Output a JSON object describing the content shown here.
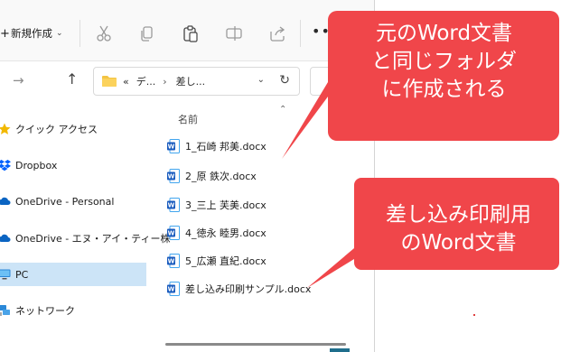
{
  "toolbar": {
    "new_label": "新規作成",
    "icons": [
      "cut-icon",
      "copy-icon",
      "paste-icon",
      "rename-icon",
      "share-icon"
    ],
    "more_label": "•••"
  },
  "address": {
    "overflow": "«",
    "crumb1": "デ...",
    "crumb2": "差し..."
  },
  "nav": {
    "items": [
      {
        "label": "クイック アクセス",
        "icon": "star-icon"
      },
      {
        "label": "Dropbox",
        "icon": "dropbox-icon"
      },
      {
        "label": "OneDrive - Personal",
        "icon": "cloud-icon"
      },
      {
        "label": "OneDrive - エヌ・アイ・ティー株",
        "icon": "cloud-icon"
      },
      {
        "label": "PC",
        "icon": "pc-icon",
        "selected": true
      },
      {
        "label": "ネットワーク",
        "icon": "network-icon"
      }
    ]
  },
  "files": {
    "column_header": "名前",
    "items": [
      "1_石崎 邦美.docx",
      "2_原 鉄次.docx",
      "3_三上 芙美.docx",
      "4_徳永 睦男.docx",
      "5_広瀬 直紀.docx",
      "差し込み印刷サンプル.docx"
    ]
  },
  "callouts": {
    "top": {
      "lines": [
        "元のWord文書",
        "と同じフォルダ",
        "に作成される"
      ],
      "color": "#f0464a"
    },
    "bottom": {
      "lines": [
        "差し込み印刷用",
        "のWord文書"
      ],
      "color": "#f0464a"
    }
  },
  "colors": {
    "accent": "#0067c0",
    "selected_bg": "#cce4f7",
    "callout": "#f0464a",
    "word_blue": "#185abd"
  }
}
